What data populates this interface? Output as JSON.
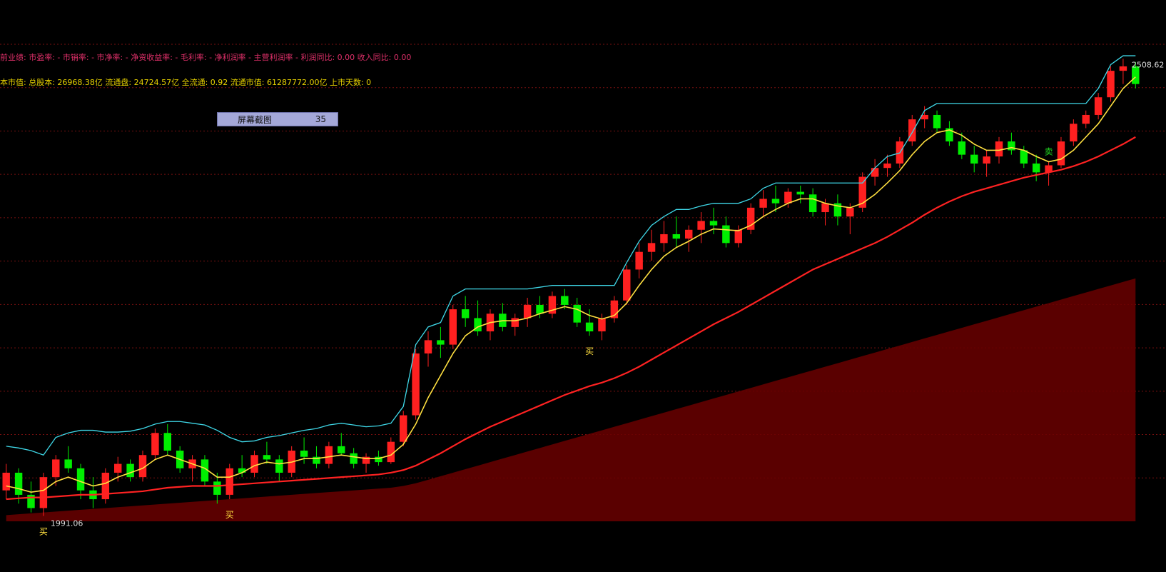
{
  "info": {
    "financial": "前业绩: 市盈率: - 市销率: - 市净率: - 净资收益率: - 毛利率: - 净利润率 - 主营利润率 - 利润同比: 0.00 收入同比: 0.00",
    "capital": "本市值: 总股本: 26968.38亿 流通盘: 24724.57亿 全流通: 0.92 流通市值: 61287772.00亿 上市天数: 0"
  },
  "capture_button": {
    "label": "屏幕截图",
    "count": "35"
  },
  "colors": {
    "background": "#000000",
    "grid": "#7a1010",
    "up": "#ff2020",
    "down": "#00ee00",
    "band": "#6a0000",
    "upper": "#3fd8e8"
  },
  "chart_data": {
    "type": "candlestick",
    "price_high_label": "2508.62",
    "price_low_label": "1991.06",
    "ylim": [
      1985,
      2525
    ],
    "grid": true,
    "signal_labels": {
      "buy": "买",
      "sell": "卖"
    },
    "ohlc": [
      [
        2020,
        2050,
        2010,
        2040
      ],
      [
        2040,
        2045,
        2005,
        2015
      ],
      [
        2015,
        2030,
        1995,
        2000
      ],
      [
        2000,
        2040,
        1991.06,
        2035
      ],
      [
        2035,
        2060,
        2025,
        2055
      ],
      [
        2055,
        2070,
        2040,
        2045
      ],
      [
        2045,
        2050,
        2010,
        2020
      ],
      [
        2020,
        2035,
        2000,
        2010
      ],
      [
        2010,
        2045,
        2005,
        2040
      ],
      [
        2040,
        2058,
        2030,
        2050
      ],
      [
        2050,
        2055,
        2030,
        2035
      ],
      [
        2035,
        2065,
        2030,
        2060
      ],
      [
        2060,
        2090,
        2055,
        2085
      ],
      [
        2085,
        2095,
        2060,
        2065
      ],
      [
        2065,
        2070,
        2040,
        2045
      ],
      [
        2045,
        2060,
        2030,
        2055
      ],
      [
        2055,
        2060,
        2025,
        2030
      ],
      [
        2030,
        2040,
        2005,
        2015
      ],
      [
        2015,
        2050,
        2010,
        2045
      ],
      [
        2045,
        2060,
        2035,
        2040
      ],
      [
        2040,
        2065,
        2035,
        2060
      ],
      [
        2060,
        2075,
        2050,
        2055
      ],
      [
        2055,
        2060,
        2030,
        2040
      ],
      [
        2040,
        2070,
        2035,
        2065
      ],
      [
        2065,
        2080,
        2050,
        2058
      ],
      [
        2058,
        2070,
        2045,
        2050
      ],
      [
        2050,
        2075,
        2045,
        2070
      ],
      [
        2070,
        2085,
        2060,
        2062
      ],
      [
        2062,
        2068,
        2045,
        2050
      ],
      [
        2050,
        2062,
        2040,
        2058
      ],
      [
        2058,
        2065,
        2048,
        2052
      ],
      [
        2052,
        2080,
        2050,
        2075
      ],
      [
        2075,
        2110,
        2070,
        2105
      ],
      [
        2105,
        2180,
        2100,
        2175
      ],
      [
        2175,
        2200,
        2160,
        2190
      ],
      [
        2190,
        2205,
        2170,
        2185
      ],
      [
        2185,
        2230,
        2180,
        2225
      ],
      [
        2225,
        2240,
        2205,
        2215
      ],
      [
        2215,
        2235,
        2195,
        2200
      ],
      [
        2200,
        2225,
        2190,
        2220
      ],
      [
        2220,
        2232,
        2200,
        2205
      ],
      [
        2205,
        2220,
        2195,
        2215
      ],
      [
        2215,
        2238,
        2205,
        2230
      ],
      [
        2230,
        2240,
        2215,
        2220
      ],
      [
        2220,
        2245,
        2215,
        2240
      ],
      [
        2240,
        2248,
        2225,
        2230
      ],
      [
        2230,
        2238,
        2205,
        2210
      ],
      [
        2210,
        2225,
        2195,
        2200
      ],
      [
        2200,
        2220,
        2190,
        2215
      ],
      [
        2215,
        2240,
        2210,
        2235
      ],
      [
        2235,
        2275,
        2230,
        2270
      ],
      [
        2270,
        2300,
        2260,
        2290
      ],
      [
        2290,
        2315,
        2280,
        2300
      ],
      [
        2300,
        2325,
        2290,
        2310
      ],
      [
        2310,
        2330,
        2295,
        2305
      ],
      [
        2305,
        2320,
        2290,
        2315
      ],
      [
        2315,
        2335,
        2300,
        2325
      ],
      [
        2325,
        2340,
        2310,
        2320
      ],
      [
        2320,
        2330,
        2295,
        2300
      ],
      [
        2300,
        2320,
        2295,
        2315
      ],
      [
        2315,
        2345,
        2310,
        2340
      ],
      [
        2340,
        2360,
        2330,
        2350
      ],
      [
        2350,
        2365,
        2335,
        2345
      ],
      [
        2345,
        2362,
        2340,
        2358
      ],
      [
        2358,
        2365,
        2345,
        2355
      ],
      [
        2355,
        2362,
        2330,
        2335
      ],
      [
        2335,
        2350,
        2320,
        2345
      ],
      [
        2345,
        2355,
        2320,
        2330
      ],
      [
        2330,
        2345,
        2310,
        2340
      ],
      [
        2340,
        2380,
        2335,
        2375
      ],
      [
        2375,
        2395,
        2365,
        2385
      ],
      [
        2385,
        2400,
        2375,
        2390
      ],
      [
        2390,
        2420,
        2385,
        2415
      ],
      [
        2415,
        2445,
        2410,
        2440
      ],
      [
        2440,
        2455,
        2430,
        2445
      ],
      [
        2445,
        2450,
        2425,
        2430
      ],
      [
        2430,
        2438,
        2410,
        2415
      ],
      [
        2415,
        2425,
        2395,
        2400
      ],
      [
        2400,
        2410,
        2380,
        2390
      ],
      [
        2390,
        2405,
        2375,
        2398
      ],
      [
        2398,
        2420,
        2390,
        2415
      ],
      [
        2415,
        2425,
        2400,
        2405
      ],
      [
        2405,
        2410,
        2385,
        2390
      ],
      [
        2390,
        2400,
        2370,
        2380
      ],
      [
        2380,
        2392,
        2365,
        2388
      ],
      [
        2388,
        2420,
        2385,
        2415
      ],
      [
        2415,
        2440,
        2410,
        2435
      ],
      [
        2435,
        2450,
        2430,
        2445
      ],
      [
        2445,
        2470,
        2440,
        2465
      ],
      [
        2465,
        2500,
        2460,
        2495
      ],
      [
        2495,
        2508.62,
        2480,
        2500
      ],
      [
        2500,
        2505,
        2475,
        2480
      ]
    ],
    "ma_fast": [
      2025,
      2022,
      2018,
      2020,
      2030,
      2035,
      2030,
      2025,
      2028,
      2035,
      2040,
      2045,
      2055,
      2060,
      2055,
      2050,
      2045,
      2035,
      2035,
      2040,
      2048,
      2052,
      2050,
      2052,
      2056,
      2056,
      2058,
      2060,
      2058,
      2056,
      2056,
      2060,
      2072,
      2095,
      2125,
      2150,
      2175,
      2195,
      2205,
      2210,
      2212,
      2212,
      2215,
      2220,
      2224,
      2228,
      2225,
      2218,
      2214,
      2218,
      2232,
      2252,
      2270,
      2285,
      2295,
      2302,
      2310,
      2316,
      2315,
      2314,
      2320,
      2330,
      2338,
      2345,
      2350,
      2350,
      2345,
      2342,
      2340,
      2345,
      2355,
      2368,
      2382,
      2400,
      2415,
      2425,
      2428,
      2422,
      2412,
      2405,
      2405,
      2408,
      2405,
      2398,
      2392,
      2395,
      2405,
      2420,
      2435,
      2455,
      2475,
      2488
    ],
    "ma_slow": [
      2010,
      2011,
      2012,
      2012,
      2013,
      2014,
      2015,
      2015,
      2016,
      2017,
      2018,
      2019,
      2021,
      2023,
      2024,
      2025,
      2025,
      2025,
      2026,
      2027,
      2028,
      2029,
      2030,
      2031,
      2032,
      2033,
      2034,
      2035,
      2036,
      2037,
      2038,
      2040,
      2043,
      2048,
      2055,
      2062,
      2070,
      2078,
      2085,
      2092,
      2098,
      2104,
      2110,
      2116,
      2122,
      2128,
      2133,
      2138,
      2142,
      2147,
      2153,
      2160,
      2168,
      2176,
      2184,
      2192,
      2200,
      2208,
      2215,
      2222,
      2230,
      2238,
      2246,
      2254,
      2262,
      2270,
      2276,
      2282,
      2288,
      2294,
      2300,
      2307,
      2315,
      2323,
      2332,
      2340,
      2347,
      2353,
      2358,
      2362,
      2366,
      2370,
      2374,
      2377,
      2380,
      2383,
      2387,
      2392,
      2398,
      2405,
      2412,
      2420
    ],
    "upper_channel": [
      2070,
      2068,
      2065,
      2060,
      2080,
      2085,
      2088,
      2088,
      2086,
      2086,
      2087,
      2090,
      2095,
      2098,
      2098,
      2096,
      2094,
      2088,
      2080,
      2075,
      2076,
      2080,
      2082,
      2085,
      2088,
      2090,
      2094,
      2096,
      2094,
      2092,
      2093,
      2096,
      2115,
      2185,
      2205,
      2210,
      2240,
      2248,
      2248,
      2248,
      2248,
      2248,
      2248,
      2250,
      2252,
      2252,
      2252,
      2252,
      2252,
      2252,
      2278,
      2302,
      2320,
      2330,
      2338,
      2338,
      2342,
      2345,
      2345,
      2345,
      2350,
      2362,
      2368,
      2368,
      2368,
      2368,
      2368,
      2368,
      2368,
      2368,
      2385,
      2398,
      2402,
      2425,
      2450,
      2458,
      2458,
      2458,
      2458,
      2458,
      2458,
      2458,
      2458,
      2458,
      2458,
      2458,
      2458,
      2458,
      2475,
      2502,
      2512,
      2512
    ],
    "lower_band": [
      1992,
      1993,
      1994,
      1995,
      1996,
      1997,
      1998,
      1999,
      2000,
      2001,
      2002,
      2003,
      2004,
      2005,
      2006,
      2007,
      2008,
      2009,
      2010,
      2011,
      2012,
      2013,
      2014,
      2015,
      2016,
      2017,
      2018,
      2019,
      2020,
      2021,
      2022,
      2023,
      2025,
      2028,
      2032,
      2036,
      2040,
      2044,
      2048,
      2052,
      2056,
      2060,
      2064,
      2068,
      2072,
      2076,
      2080,
      2084,
      2088,
      2092,
      2096,
      2100,
      2104,
      2108,
      2112,
      2116,
      2120,
      2124,
      2128,
      2132,
      2136,
      2140,
      2144,
      2148,
      2152,
      2156,
      2160,
      2164,
      2168,
      2172,
      2176,
      2180,
      2184,
      2188,
      2192,
      2196,
      2200,
      2204,
      2208,
      2212,
      2216,
      2220,
      2224,
      2228,
      2232,
      2236,
      2240,
      2244,
      2248,
      2252,
      2256,
      2260
    ]
  }
}
